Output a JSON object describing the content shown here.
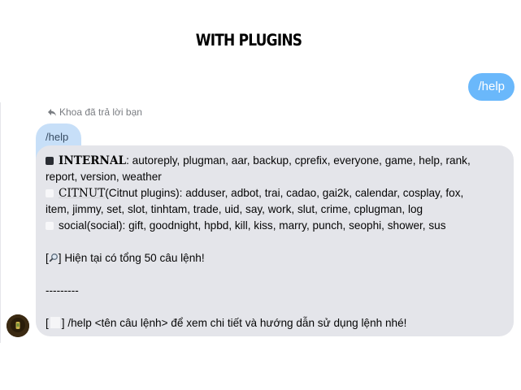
{
  "header": {
    "title": "WITH PLUGINS"
  },
  "sent_message": {
    "text": "/help"
  },
  "reply": {
    "note": "Khoa đã trả lời bạn",
    "quoted_text": "/help"
  },
  "message": {
    "internal_label": "INTERNAL",
    "internal_text_1": ": autoreply, plugman, aar, backup, cprefix, everyone, game, help, rank,",
    "internal_text_2": "report, version, weather",
    "citnut_label": "CITNUT",
    "citnut_text_1": "(Citnut plugins): adduser, adbot, trai, cadao, gai2k, calendar, cosplay, fox,",
    "citnut_text_2": "item, jimmy, set, slot, tinhtam, trade, uid, say, work, slut, crime, cplugman, log",
    "social_text": "social(social): gift, goodnight, hpbd, kill, kiss, marry, punch, seophi, shower, sus",
    "total_pre": "[",
    "total_text": "] Hiện tại có tổng 50 câu lệnh!",
    "separator": "---------",
    "help_pre": "[",
    "help_text": "] /help <tên câu lệnh> để xem chi tiết và hướng dẫn sử dụng lệnh nhé!"
  },
  "colors": {
    "sent_bubble": "#6ab8fb",
    "quote_bubble": "#c7dff8",
    "message_bubble": "#e4e5ea"
  }
}
